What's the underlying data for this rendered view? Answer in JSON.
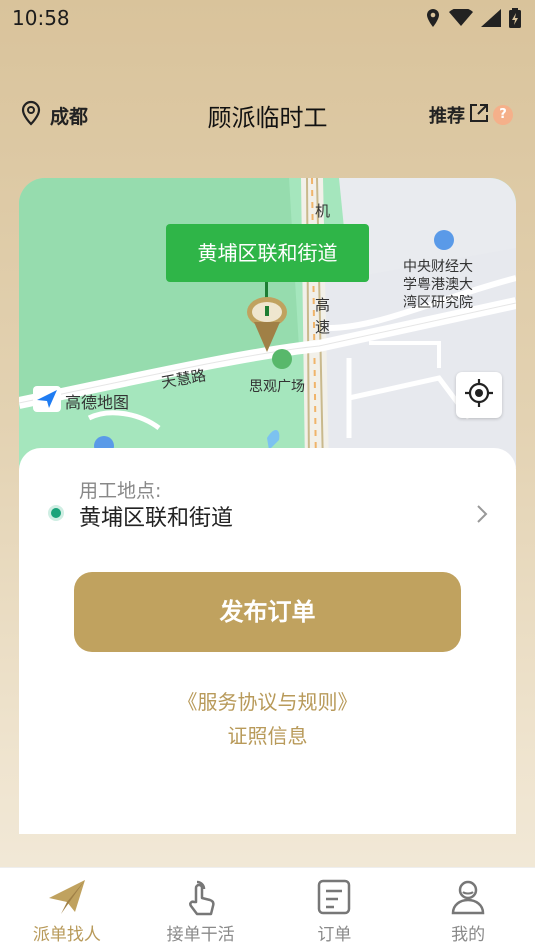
{
  "status": {
    "time": "10:58"
  },
  "header": {
    "city": "成都",
    "title": "顾派临时工",
    "recommend_label": "推荐",
    "help_badge": "?"
  },
  "map": {
    "bubble_text": "黄埔区联和街道",
    "provider_logo": "高德地图",
    "labels": {
      "road_tianhui": "天慧路",
      "park_siguan": "思观广场",
      "highway_ji": "机",
      "highway_gao": "高",
      "highway_su": "速",
      "institute_line1": "中央财经大",
      "institute_line2": "学粤港澳大",
      "institute_line3": "湾区研究院"
    }
  },
  "worksite": {
    "label": "用工地点:",
    "value": "黄埔区联和街道"
  },
  "actions": {
    "publish_label": "发布订单",
    "agreement_label": "《服务协议与规则》",
    "license_label": "证照信息"
  },
  "nav": {
    "items": [
      {
        "label": "派单找人",
        "icon": "paper-plane-icon",
        "active": true
      },
      {
        "label": "接单干活",
        "icon": "tap-hand-icon",
        "active": false
      },
      {
        "label": "订单",
        "icon": "order-list-icon",
        "active": false
      },
      {
        "label": "我的",
        "icon": "profile-icon",
        "active": false
      }
    ]
  },
  "colors": {
    "accent": "#c0a25f",
    "accent_text": "#b89a5a",
    "map_bubble": "#2fb548",
    "worksite_dot": "#1aa37a",
    "help_badge": "#f5b08a"
  }
}
